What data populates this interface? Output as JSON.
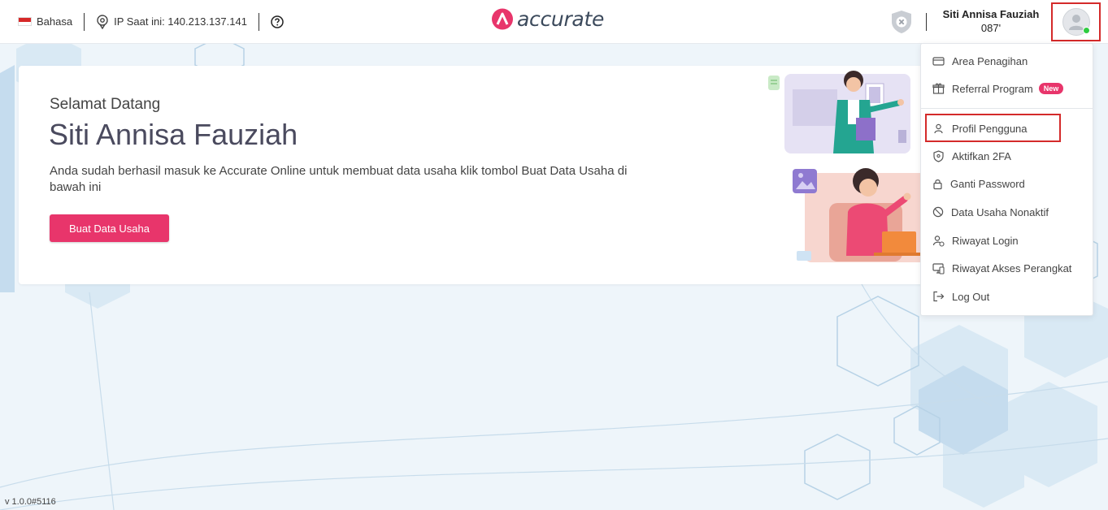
{
  "header": {
    "language_label": "Bahasa",
    "ip_label": "IP Saat ini: 140.213.137.141",
    "logo_text": "accurate",
    "user_name": "Siti Annisa Fauziah",
    "user_phone": "087'"
  },
  "welcome": {
    "greeting": "Selamat Datang",
    "name": "Siti Annisa Fauziah",
    "description": "Anda sudah berhasil masuk ke Accurate Online untuk membuat data usaha klik tombol Buat Data Usaha di bawah ini",
    "button_label": "Buat Data Usaha"
  },
  "menu": {
    "items": [
      {
        "label": "Area Penagihan",
        "icon": "card-icon"
      },
      {
        "label": "Referral Program",
        "icon": "gift-icon",
        "badge": "New"
      },
      {
        "label": "Profil Pengguna",
        "icon": "user-icon"
      },
      {
        "label": "Aktifkan 2FA",
        "icon": "shield-icon"
      },
      {
        "label": "Ganti Password",
        "icon": "lock-icon"
      },
      {
        "label": "Data Usaha Nonaktif",
        "icon": "ban-icon"
      },
      {
        "label": "Riwayat Login",
        "icon": "user-history-icon"
      },
      {
        "label": "Riwayat Akses Perangkat",
        "icon": "device-icon"
      },
      {
        "label": "Log Out",
        "icon": "logout-icon"
      }
    ]
  },
  "footer": {
    "version": "v 1.0.0#5116"
  },
  "colors": {
    "accent": "#e8356b",
    "highlight_border": "#d42a2a",
    "status_online": "#2ecc40"
  }
}
